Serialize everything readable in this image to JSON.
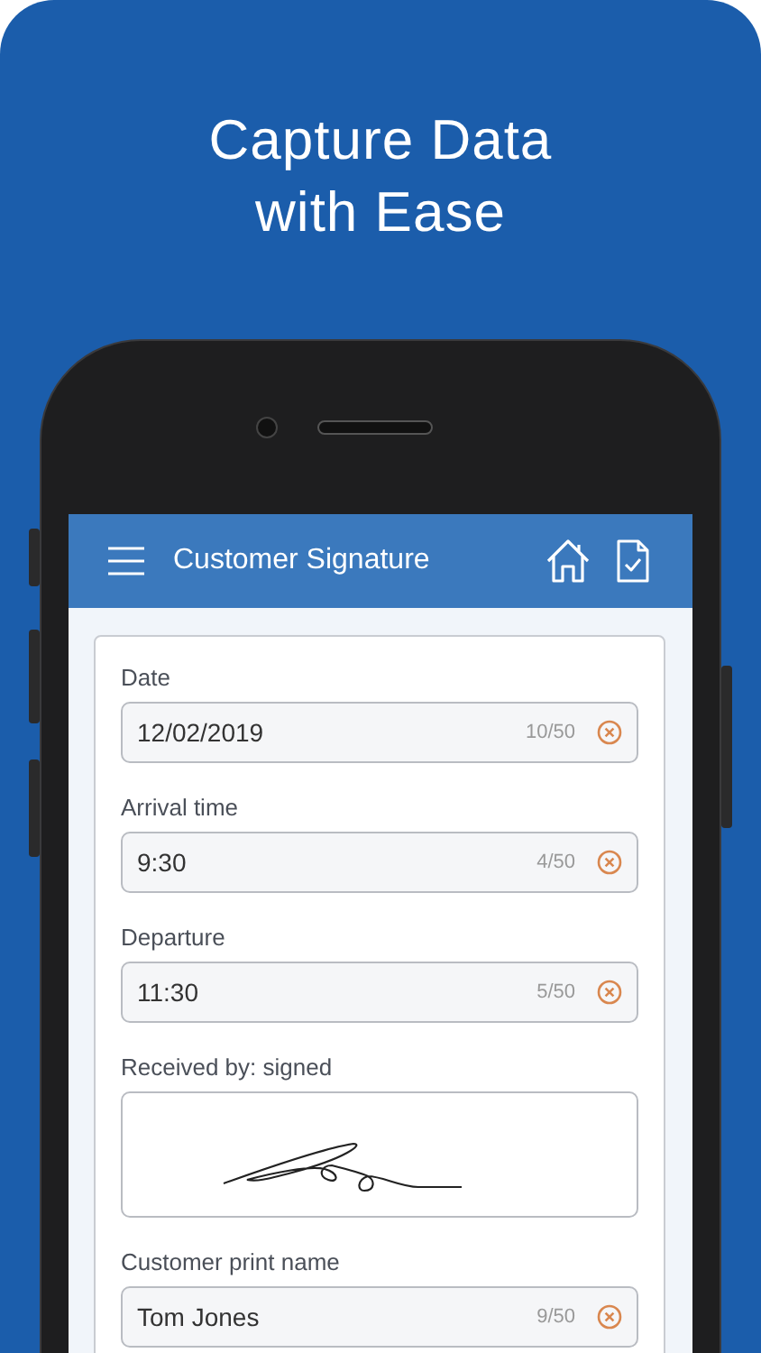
{
  "headline": [
    "Capture Data",
    "with Ease"
  ],
  "app_bar": {
    "title": "Customer Signature"
  },
  "fields": [
    {
      "kind": "text",
      "label": "Date",
      "value": "12/02/2019",
      "counter": "10/50"
    },
    {
      "kind": "text",
      "label": "Arrival time",
      "value": "9:30",
      "counter": "4/50"
    },
    {
      "kind": "text",
      "label": "Departure",
      "value": "11:30",
      "counter": "5/50"
    },
    {
      "kind": "signature",
      "label": "Received by: signed"
    },
    {
      "kind": "text",
      "label": "Customer print name",
      "value": "Tom Jones",
      "counter": "9/50"
    }
  ]
}
